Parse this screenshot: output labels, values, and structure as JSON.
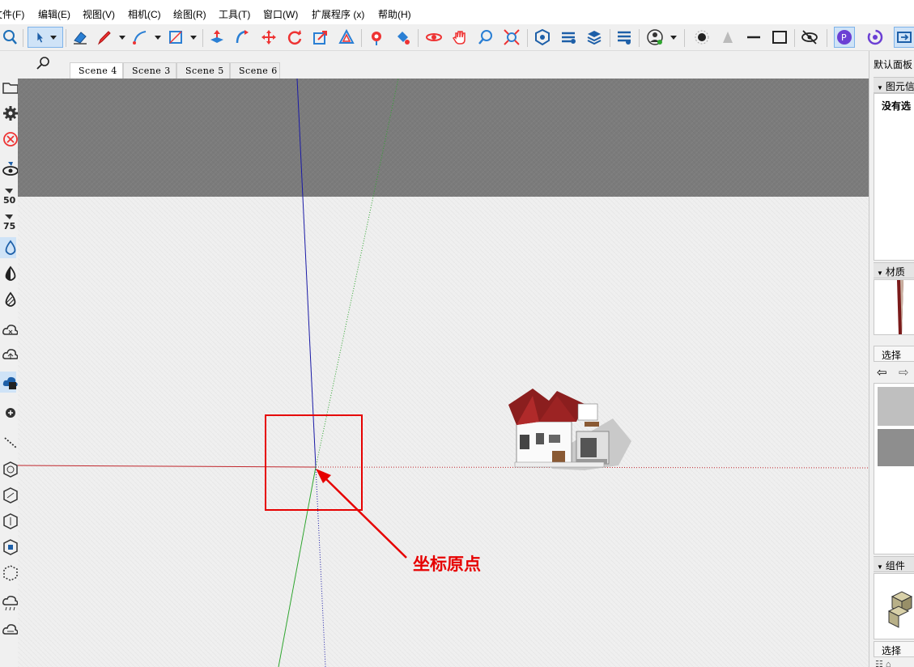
{
  "menubar": {
    "items": [
      "文件(F)",
      "编辑(E)",
      "视图(V)",
      "相机(C)",
      "绘图(R)",
      "工具(T)",
      "窗口(W)",
      "扩展程序 (x)",
      "帮助(H)"
    ]
  },
  "toolbar": {
    "icons": [
      "zoom-icon",
      "select-arrow-icon",
      "eraser-icon",
      "pencil-line-icon",
      "arc-icon",
      "rectangle-icon",
      "push-pull-icon",
      "follow-me-icon",
      "move-icon",
      "rotate-icon",
      "scale-icon",
      "offset-icon",
      "tape-measure-icon",
      "paint-bucket-icon",
      "orbit-icon",
      "pan-icon",
      "zoom-view-icon",
      "zoom-extents-icon",
      "3d-warehouse-icon",
      "extension-warehouse-icon",
      "layerout-icon",
      "extension-manager-icon",
      "profile-icon",
      "shadow-dot-icon",
      "shadow-triangle-icon",
      "line-style-icon",
      "window-box-icon",
      "hide-eye-icon",
      "plugin-p-icon",
      "plugin-spin-icon",
      "plugin-next-icon"
    ]
  },
  "scene_tabs": {
    "tabs": [
      "Scene 4",
      "Scene 3",
      "Scene 5",
      "Scene 6"
    ],
    "active": "Scene 4"
  },
  "viewport": {
    "annotation_label": "坐标原点",
    "annotation_color": "#e60000",
    "axis_colors": {
      "red": "#c1272d",
      "green": "#2fa52f",
      "blue": "#1a1aa6"
    },
    "sky_color": "#7b7b7b",
    "ground_color": "#efefef"
  },
  "right_panel": {
    "title": "默认面板",
    "entity_info_header": "图元信",
    "no_selection": "没有选",
    "materials_header": "材质",
    "select_label": "选择",
    "components_header": "组件",
    "components_select_label": "选择"
  },
  "left_toolbar": {
    "icons": [
      "open-folder-icon",
      "gear-icon",
      "cancel-icon",
      "eye-icon",
      "badge-50-icon",
      "badge-75-icon",
      "drop-outline-icon",
      "half-drop-icon",
      "hatched-drop-icon",
      "cloud-x-icon",
      "cloud-upload-icon",
      "cloud-sync-icon",
      "plus-icon",
      "dotted-line-icon",
      "section-icon",
      "section-icon-2",
      "section-icon-3",
      "section-icon-4",
      "section-icon-5",
      "cloud-rain-icon",
      "cloud-icon"
    ]
  }
}
